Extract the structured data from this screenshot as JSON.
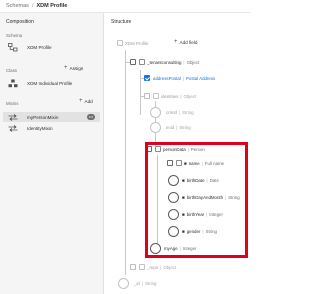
{
  "breadcrumb": {
    "root": "Schemas",
    "separator": "/",
    "current": "XDM Profile"
  },
  "left": {
    "composition_heading": "Composition",
    "schema_heading": "Schema",
    "schema_name": "XDM Profile",
    "class_heading": "Class",
    "assign_label": "Assign",
    "class_name": "XDM Individual Profile",
    "mixins_heading": "Mixins",
    "add_label": "Add",
    "mixins": [
      {
        "label": "myPersonMixin"
      },
      {
        "label": "IdentityMixin"
      }
    ]
  },
  "structure": {
    "heading": "Structure",
    "root_label": "XDM Profile",
    "add_field_label": "Add field",
    "fields": [
      {
        "name": "_tenantconsulting",
        "type": "Object"
      },
      {
        "name": "addressPostal",
        "type": "Postal Address"
      },
      {
        "name": "identities",
        "type": "Object"
      },
      {
        "name": "crmId",
        "type": "String"
      },
      {
        "name": "ecid",
        "type": "String"
      },
      {
        "name": "personData",
        "type": "Person"
      },
      {
        "name": "name",
        "type": "Full name"
      },
      {
        "name": "birthDate",
        "type": "Date"
      },
      {
        "name": "birthDayAndMonth",
        "type": "String"
      },
      {
        "name": "birthYear",
        "type": "Integer"
      },
      {
        "name": "gender",
        "type": "String"
      },
      {
        "name": "myAge",
        "type": "Integer"
      },
      {
        "name": "_repo",
        "type": "Object"
      },
      {
        "name": "_id",
        "type": "String"
      }
    ]
  },
  "colors": {
    "accent": "#1473e6",
    "highlight_box": "#e0001b",
    "panel_bg": "#f5f5f5"
  },
  "icons": [
    "schema-icon",
    "class-icon",
    "mixin-icon",
    "lock-icon",
    "plus-icon",
    "more-icon"
  ]
}
